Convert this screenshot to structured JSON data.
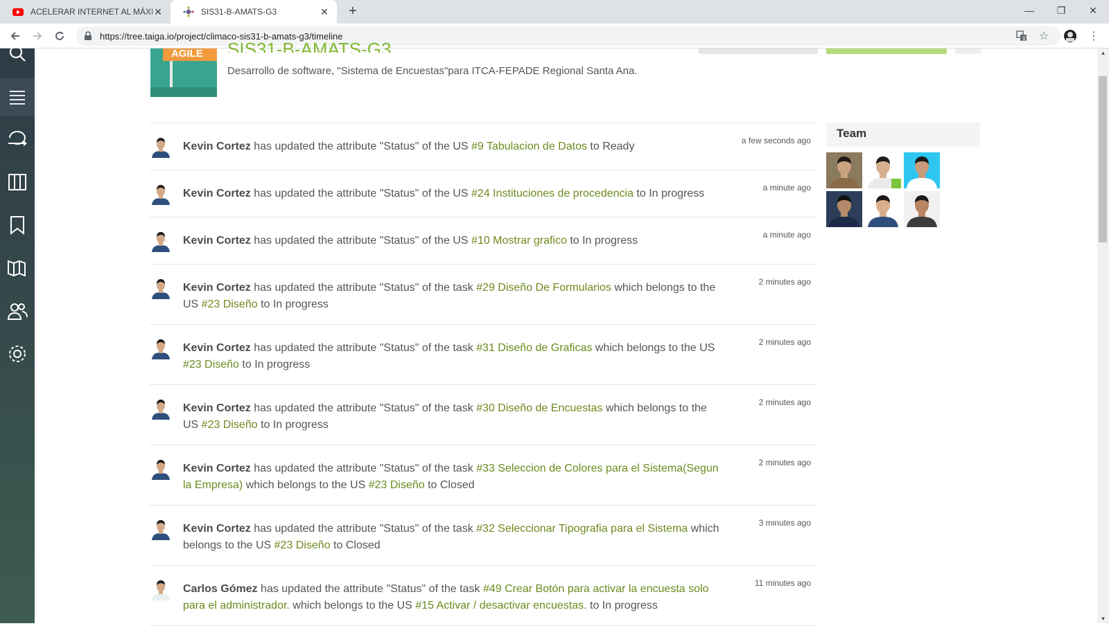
{
  "browser": {
    "tabs": [
      {
        "title": "ACELERAR INTERNET AL MÁXIMO",
        "favicon": "youtube-icon",
        "active": false
      },
      {
        "title": "SIS31-B-AMATS-G3",
        "favicon": "taiga-icon",
        "active": true
      }
    ],
    "url": "https://tree.taiga.io/project/climaco-sis31-b-amats-g3/timeline"
  },
  "sidebar": {
    "items": [
      {
        "name": "search-icon",
        "selected": false
      },
      {
        "name": "menu-icon",
        "selected": true
      },
      {
        "name": "timeline-icon",
        "selected": false
      },
      {
        "name": "kanban-icon",
        "selected": false
      },
      {
        "name": "bookmark-icon",
        "selected": false
      },
      {
        "name": "wiki-icon",
        "selected": false
      },
      {
        "name": "team-icon",
        "selected": false
      },
      {
        "name": "settings-icon",
        "selected": false
      }
    ]
  },
  "project": {
    "logo_text": "AGILE",
    "title": "SIS31-B-AMATS-G3",
    "description": "Desarrollo de software, \"Sistema de Encuestas\"para ITCA-FEPADE Regional Santa Ana."
  },
  "timeline": [
    {
      "user": "Kevin Cortez",
      "time": "a few seconds ago",
      "parts": [
        {
          "t": " has updated the attribute \"Status\" of the US "
        },
        {
          "l": "#9 Tabulacion de Datos"
        },
        {
          "t": " to Ready"
        }
      ]
    },
    {
      "user": "Kevin Cortez",
      "time": "a minute ago",
      "parts": [
        {
          "t": " has updated the attribute \"Status\" of the US "
        },
        {
          "l": "#24 Instituciones de procedencia"
        },
        {
          "t": " to In progress"
        }
      ]
    },
    {
      "user": "Kevin Cortez",
      "time": "a minute ago",
      "parts": [
        {
          "t": " has updated the attribute \"Status\" of the US "
        },
        {
          "l": "#10 Mostrar grafico"
        },
        {
          "t": " to In progress"
        }
      ]
    },
    {
      "user": "Kevin Cortez",
      "time": "2 minutes ago",
      "parts": [
        {
          "t": " has updated the attribute \"Status\" of the task "
        },
        {
          "l": "#29 Diseño De Formularios"
        },
        {
          "t": " which belongs to the US "
        },
        {
          "l": "#23 Diseño"
        },
        {
          "t": " to In progress"
        }
      ]
    },
    {
      "user": "Kevin Cortez",
      "time": "2 minutes ago",
      "parts": [
        {
          "t": " has updated the attribute \"Status\" of the task "
        },
        {
          "l": "#31 Diseño de Graficas"
        },
        {
          "t": " which belongs to the US "
        },
        {
          "l": "#23 Diseño"
        },
        {
          "t": " to In progress"
        }
      ]
    },
    {
      "user": "Kevin Cortez",
      "time": "2 minutes ago",
      "parts": [
        {
          "t": " has updated the attribute \"Status\" of the task "
        },
        {
          "l": "#30 Diseño de Encuestas"
        },
        {
          "t": " which belongs to the US "
        },
        {
          "l": "#23 Diseño"
        },
        {
          "t": " to In progress"
        }
      ]
    },
    {
      "user": "Kevin Cortez",
      "time": "2 minutes ago",
      "parts": [
        {
          "t": " has updated the attribute \"Status\" of the task "
        },
        {
          "l": "#33 Seleccion de Colores para el Sistema(Segun la Empresa)"
        },
        {
          "t": " which belongs to the US "
        },
        {
          "l": "#23 Diseño"
        },
        {
          "t": " to Closed"
        }
      ]
    },
    {
      "user": "Kevin Cortez",
      "time": "3 minutes ago",
      "parts": [
        {
          "t": " has updated the attribute \"Status\" of the task "
        },
        {
          "l": "#32 Seleccionar Tipografia para el Sistema"
        },
        {
          "t": " which belongs to the US "
        },
        {
          "l": "#23 Diseño"
        },
        {
          "t": " to Closed"
        }
      ]
    },
    {
      "user": "Carlos Gómez",
      "time": "11 minutes ago",
      "parts": [
        {
          "t": " has updated the attribute \"Status\" of the task "
        },
        {
          "l": "#49 Crear Botón para activar la encuesta solo para el administrador."
        },
        {
          "t": " which belongs to the US "
        },
        {
          "l": "#15 Activar / desactivar encuestas."
        },
        {
          "t": " to In progress"
        }
      ]
    }
  ],
  "team": {
    "title": "Team",
    "members": [
      {
        "bg": "#8a7a5e",
        "face": "#c9a27e",
        "hair": "#1f1a17",
        "shirt": "#8b6a4a"
      },
      {
        "bg": "#ffffff",
        "face": "#d9b08e",
        "hair": "#1c1c1c",
        "shirt": "#e9e9e9",
        "badge": "#7cc43a"
      },
      {
        "bg": "#2ec6f0",
        "face": "#c99b7a",
        "hair": "#1a1a1a",
        "shirt": "#ffffff"
      },
      {
        "bg": "#2c3e5a",
        "face": "#b58a6a",
        "hair": "#111111",
        "shirt": "#1b2a46"
      },
      {
        "bg": "#ffffff",
        "face": "#d9ae8c",
        "hair": "#1f1a17",
        "shirt": "#2e4f7d"
      },
      {
        "bg": "#f0f0f0",
        "face": "#b88461",
        "hair": "#1a1a1a",
        "shirt": "#3b3b3b"
      }
    ]
  },
  "colors": {
    "link": "#6c8a1e",
    "brand_green": "#83b833",
    "sidebar": "#2e3c46"
  }
}
